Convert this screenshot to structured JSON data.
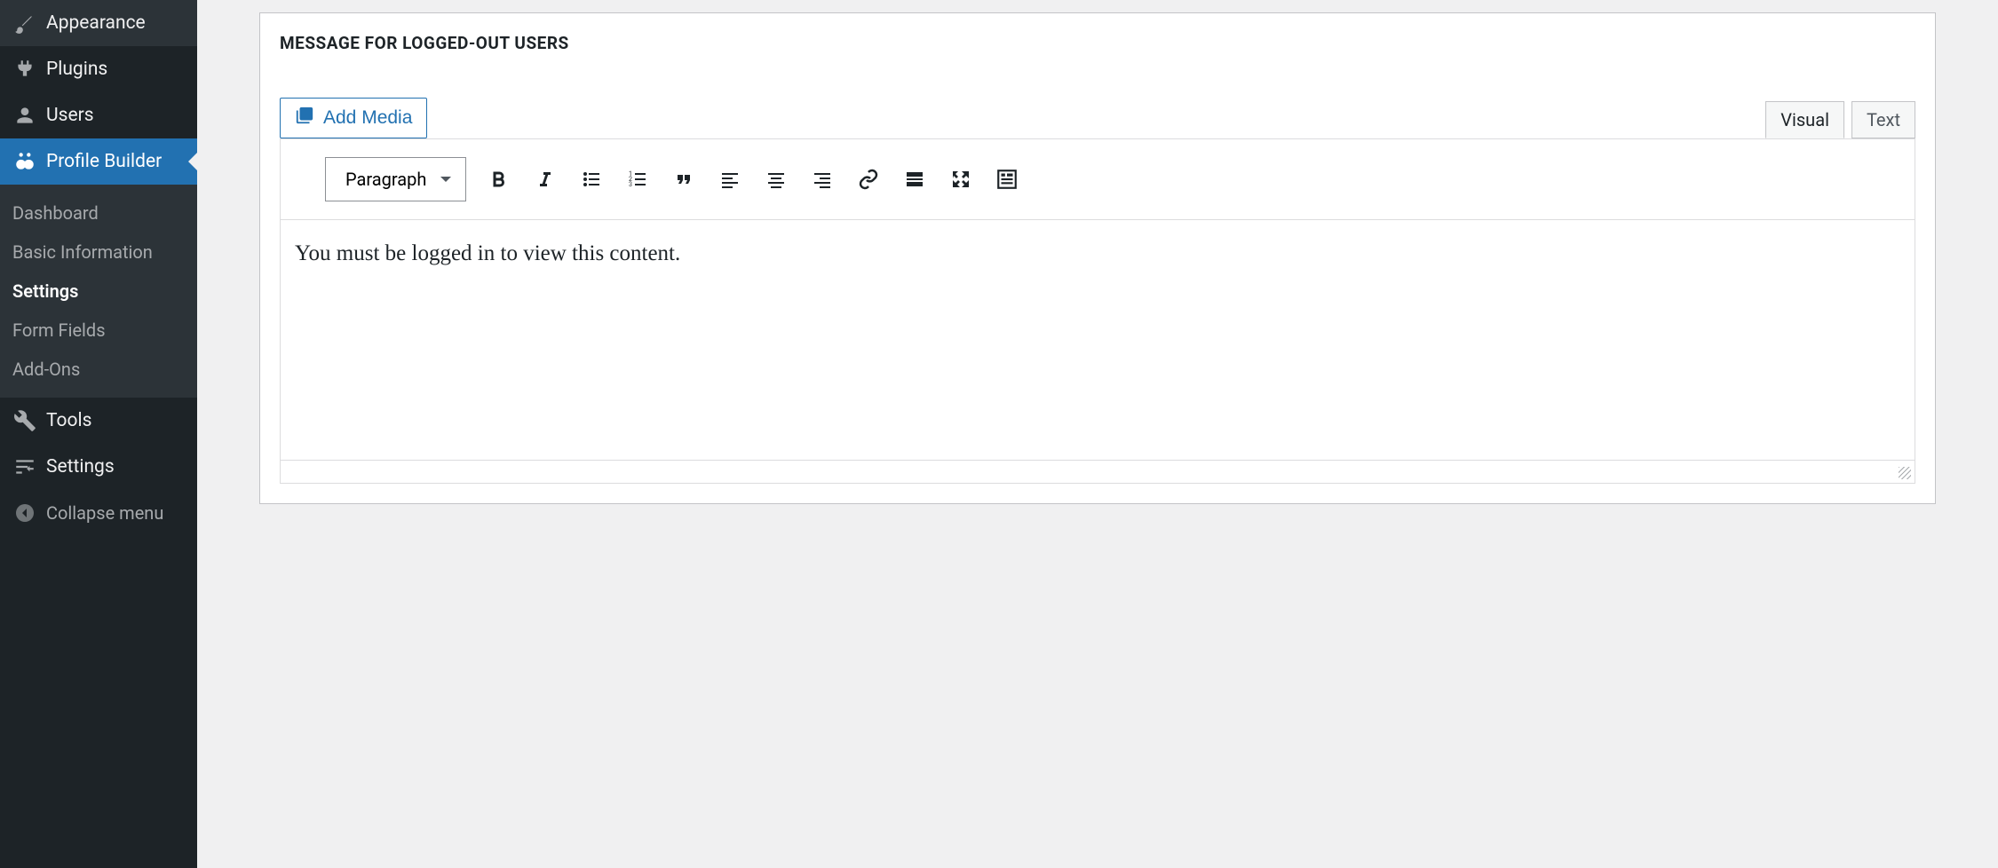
{
  "sidebar": {
    "appearance": "Appearance",
    "plugins": "Plugins",
    "users": "Users",
    "profile_builder": "Profile Builder",
    "tools": "Tools",
    "settings": "Settings",
    "collapse": "Collapse menu"
  },
  "submenu": {
    "dashboard": "Dashboard",
    "basic_info": "Basic Information",
    "settings": "Settings",
    "form_fields": "Form Fields",
    "addons": "Add-Ons"
  },
  "panel": {
    "title": "MESSAGE FOR LOGGED-OUT USERS",
    "add_media": "Add Media",
    "tab_visual": "Visual",
    "tab_text": "Text",
    "format_select": "Paragraph",
    "content": "You must be logged in to view this content."
  }
}
